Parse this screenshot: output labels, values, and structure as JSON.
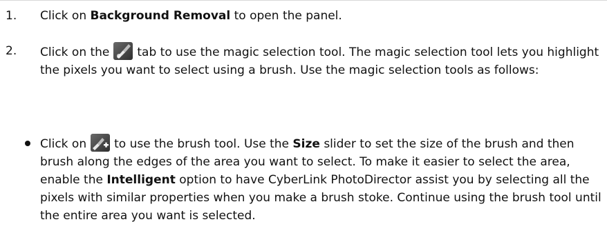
{
  "step1": {
    "number": "1.",
    "text_before": "Click on ",
    "bold": "Background Removal",
    "text_after": " to open the panel."
  },
  "step2": {
    "number": "2.",
    "text_before": "Click on the",
    "icon": "magic-selection-tab-icon",
    "text_after": "tab to use the magic selection tool. The magic selection tool lets you highlight the pixels you want to select using a brush. Use the magic selection tools as follows:"
  },
  "bullet1": {
    "text_before": "Click on",
    "icon": "brush-add-icon",
    "text_mid1": "to use the brush tool. Use the ",
    "bold1": "Size",
    "text_mid2": " slider to set the size of the brush and then brush along the edges of the area you want to select. To make it easier to select the area, enable the ",
    "bold2": "Intelligent",
    "text_after": " option to have CyberLink PhotoDirector assist you by selecting all the pixels with similar properties when you make a brush stoke. Continue using the brush tool until the entire area you want is selected."
  },
  "colors": {
    "text": "#111111",
    "icon_bg": "#4a4a4a",
    "icon_accent": "#9a9a9a"
  }
}
